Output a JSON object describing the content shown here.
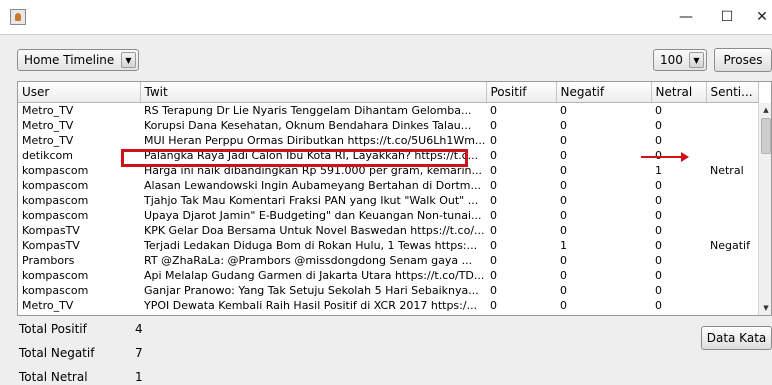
{
  "window": {
    "minimize": "—",
    "maximize": "☐",
    "close": "✕"
  },
  "toolbar": {
    "timeline_select": "Home Timeline",
    "count_select": "100",
    "proses_label": "Proses"
  },
  "table": {
    "columns": [
      "User",
      "Twit",
      "Positif",
      "Negatif",
      "Netral",
      "Senti..."
    ],
    "rows": [
      {
        "user": "Metro_TV",
        "twit": "RS Terapung Dr Lie Nyaris Tenggelam Dihantam Gelomba...",
        "positif": "0",
        "negatif": "0",
        "netral": "0",
        "sentimen": ""
      },
      {
        "user": "Metro_TV",
        "twit": "Korupsi Dana Kesehatan, Oknum Bendahara Dinkes Talau...",
        "positif": "0",
        "negatif": "0",
        "netral": "0",
        "sentimen": ""
      },
      {
        "user": "Metro_TV",
        "twit": "MUI Heran Perppu Ormas Diributkan https://t.co/5U6Lh1Wm...",
        "positif": "0",
        "negatif": "0",
        "netral": "0",
        "sentimen": ""
      },
      {
        "user": "detikcom",
        "twit": "Palangka Raya Jadi Calon Ibu Kota RI, Layakkah? https://t.c...",
        "positif": "0",
        "negatif": "0",
        "netral": "0",
        "sentimen": ""
      },
      {
        "user": "kompascom",
        "twit": "Harga ini naik dibandingkan Rp 591.000 per gram, kemarin...",
        "positif": "0",
        "negatif": "0",
        "netral": "1",
        "sentimen": "Netral"
      },
      {
        "user": "kompascom",
        "twit": "Alasan Lewandowski Ingin Aubameyang Bertahan di Dortm...",
        "positif": "0",
        "negatif": "0",
        "netral": "0",
        "sentimen": ""
      },
      {
        "user": "kompascom",
        "twit": "Tjahjo Tak Mau Komentari Fraksi PAN yang Ikut \"Walk Out\" ...",
        "positif": "0",
        "negatif": "0",
        "netral": "0",
        "sentimen": ""
      },
      {
        "user": "kompascom",
        "twit": "Upaya Djarot Jamin\" E-Budgeting\" dan Keuangan Non-tunai...",
        "positif": "0",
        "negatif": "0",
        "netral": "0",
        "sentimen": ""
      },
      {
        "user": "KompasTV",
        "twit": "KPK Gelar Doa Bersama Untuk Novel Baswedan https://t.co/...",
        "positif": "0",
        "negatif": "0",
        "netral": "0",
        "sentimen": ""
      },
      {
        "user": "KompasTV",
        "twit": "Terjadi Ledakan Diduga Bom di Rokan Hulu, 1 Tewas https:...",
        "positif": "0",
        "negatif": "1",
        "netral": "0",
        "sentimen": "Negatif"
      },
      {
        "user": "Prambors",
        "twit": "RT @ZhaRaLa: @Prambors @missdongdong Senam gaya ...",
        "positif": "0",
        "negatif": "0",
        "netral": "0",
        "sentimen": ""
      },
      {
        "user": "kompascom",
        "twit": "Api Melalap Gudang Garmen di Jakarta Utara https://t.co/TD...",
        "positif": "0",
        "negatif": "0",
        "netral": "0",
        "sentimen": ""
      },
      {
        "user": "kompascom",
        "twit": "Ganjar Pranowo: Yang Tak Setuju Sekolah 5 Hari Sebaiknya...",
        "positif": "0",
        "negatif": "0",
        "netral": "0",
        "sentimen": ""
      },
      {
        "user": "Metro_TV",
        "twit": "YPOI Dewata Kembali Raih Hasil Positif di XCR 2017 https:/...",
        "positif": "0",
        "negatif": "0",
        "netral": "0",
        "sentimen": ""
      }
    ]
  },
  "totals": {
    "positif_label": "Total Positif",
    "positif_value": "4",
    "negatif_label": "Total Negatif",
    "negatif_value": "7",
    "netral_label": "Total Netral",
    "netral_value": "1"
  },
  "data_kata_label": "Data Kata",
  "colors": {
    "highlight": "#d0101b"
  }
}
